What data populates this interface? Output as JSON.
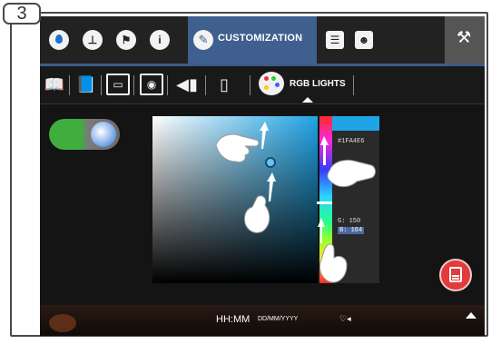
{
  "step": {
    "number": "3"
  },
  "topbar": {
    "icons": [
      "water-drop-icon",
      "clock-icon",
      "flag-icon",
      "info-icon"
    ],
    "active_tab": {
      "label": "CUSTOMIZATION",
      "icon": "pencil-icon"
    },
    "right_icons": [
      "document-icon",
      "user-profile-icon"
    ],
    "settings_icon": "wrench-icon"
  },
  "subbar": {
    "icons": [
      "book-icon",
      "blue-book-icon",
      "slideshow-icon",
      "screensaver-icon",
      "speaker-icon",
      "usb-icon"
    ],
    "active_tab": {
      "label": "RGB LIGHTS",
      "icon": "palette-icon"
    }
  },
  "color_picker": {
    "hex": "#1FA4E6",
    "g_label": "G: 150",
    "b_label": "B: 164",
    "accent": "#1fa4e6"
  },
  "bottombar": {
    "time": "HH:MM",
    "date": "DD/MM/YYYY",
    "status_icons": "♡◂"
  },
  "colors": {
    "topbar_active": "#3f5f8f",
    "toggle_on": "#3fae3f",
    "save_button": "#e23b3b"
  }
}
